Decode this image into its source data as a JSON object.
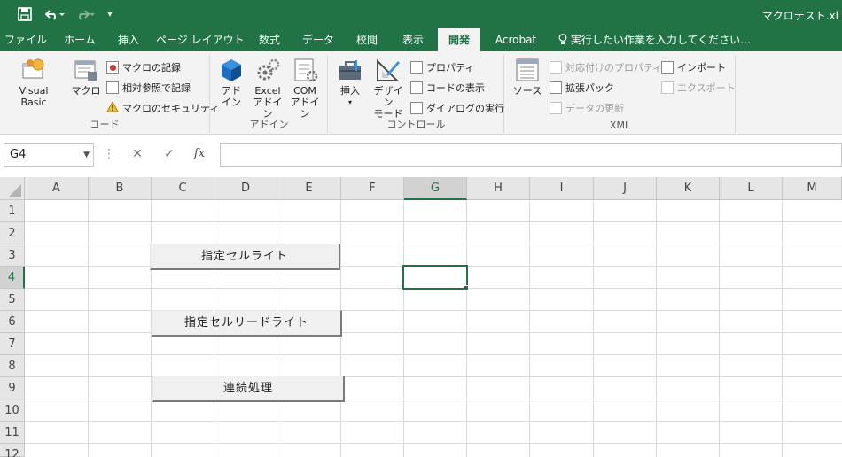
{
  "titlebar": {
    "doc_title": "マクロテスト.xl"
  },
  "tabs": [
    "ファイル",
    "ホーム",
    "挿入",
    "ページ レイアウト",
    "数式",
    "データ",
    "校閲",
    "表示",
    "開発",
    "Acrobat"
  ],
  "tell_me": "実行したい作業を入力してください…",
  "ribbon": {
    "code": {
      "label": "コード",
      "visual_basic": "Visual Basic",
      "macros": "マクロ",
      "record_macro": "マクロの記録",
      "relative_refs": "相対参照で記録",
      "macro_security": "マクロのセキュリティ"
    },
    "addins": {
      "label": "アドイン",
      "addins_l1": "アド",
      "addins_l2": "イン",
      "excel_l1": "Excel",
      "excel_l2": "アドイン",
      "com_l1": "COM",
      "com_l2": "アドイン"
    },
    "controls": {
      "label": "コントロール",
      "insert": "挿入",
      "design_l1": "デザイン",
      "design_l2": "モード",
      "properties": "プロパティ",
      "view_code": "コードの表示",
      "run_dialog": "ダイアログの実行"
    },
    "xml": {
      "label": "XML",
      "source": "ソース",
      "map_properties": "対応付けのプロパティ",
      "expansion_packs": "拡張パック",
      "refresh_data": "データの更新",
      "import": "インポート",
      "export": "エクスポート"
    }
  },
  "formula_bar": {
    "name_box": "G4",
    "fx": "fx",
    "formula": ""
  },
  "grid": {
    "columns": [
      "A",
      "B",
      "C",
      "D",
      "E",
      "F",
      "G",
      "H",
      "I",
      "J",
      "K",
      "L",
      "M"
    ],
    "rows": [
      "1",
      "2",
      "3",
      "4",
      "5",
      "6",
      "7",
      "8",
      "9",
      "10",
      "11",
      "12"
    ],
    "selected_cell": "G4"
  },
  "buttons": [
    {
      "label": "指定セルライト"
    },
    {
      "label": "指定セルリードライト"
    },
    {
      "label": "連続処理"
    }
  ],
  "colors": {
    "accent": "#217346",
    "ribbon_bg": "#f3f3f3"
  }
}
